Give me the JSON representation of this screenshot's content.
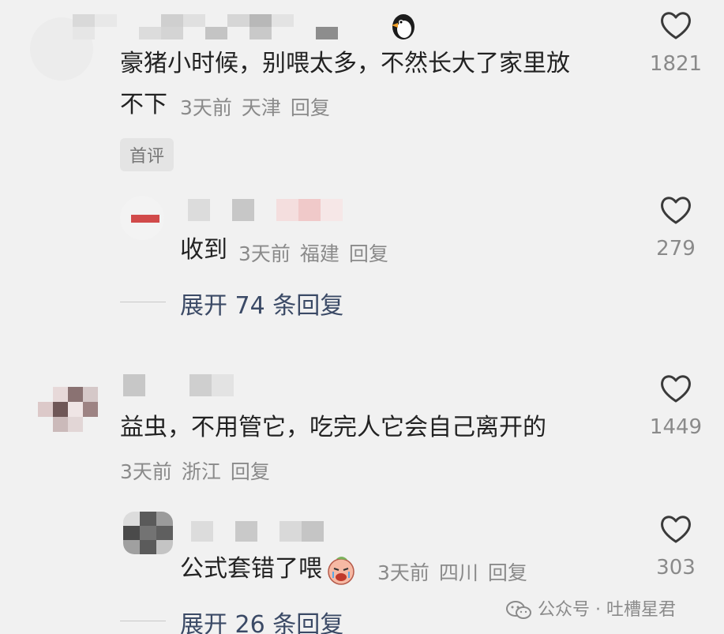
{
  "comments": [
    {
      "text_line1": "豪猪小时候，别喂太多，不然长大了家里放",
      "text_line2": "不下",
      "time": "3天前",
      "location": "天津",
      "reply": "回复",
      "likes": "1821",
      "badge": "首评",
      "username_emoji": "penguin-emoji"
    },
    {
      "text": "收到",
      "time": "3天前",
      "location": "福建",
      "reply": "回复",
      "likes": "279"
    },
    {
      "text": "益虫，不用管它，吃完人它会自己离开的",
      "time": "3天前",
      "location": "浙江",
      "reply": "回复",
      "likes": "1449"
    },
    {
      "text": "公式套错了喂",
      "emoji": "crying-face-emoji",
      "time": "3天前",
      "location": "四川",
      "reply": "回复",
      "likes": "303"
    }
  ],
  "expand_replies": [
    {
      "label": "展开",
      "count": "74",
      "suffix": "条回复"
    },
    {
      "label": "展开",
      "count": "26",
      "suffix": "条回复"
    }
  ],
  "watermark": {
    "icon": "wechat-icon",
    "text": "公众号 · 吐槽星君"
  },
  "colors": {
    "background": "#f1f1f1",
    "text": "#222222",
    "meta": "#8a8a8a",
    "expand": "#3b4a66"
  }
}
